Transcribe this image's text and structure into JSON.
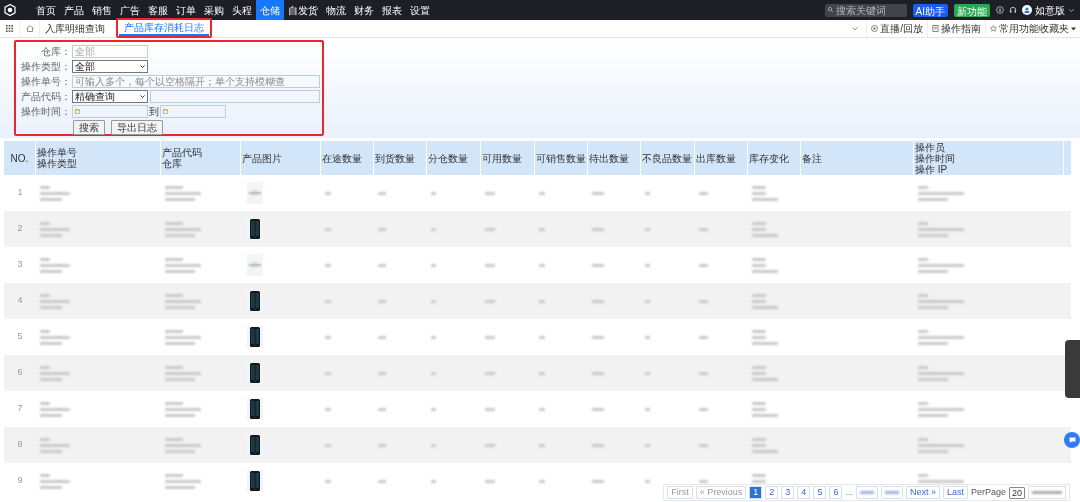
{
  "nav": {
    "items": [
      {
        "label": "首页",
        "selected": false
      },
      {
        "label": "产品",
        "selected": false
      },
      {
        "label": "销售",
        "selected": false
      },
      {
        "label": "广告",
        "selected": false
      },
      {
        "label": "客服",
        "selected": false
      },
      {
        "label": "订单",
        "selected": false
      },
      {
        "label": "采购",
        "selected": false
      },
      {
        "label": "头程",
        "selected": false
      },
      {
        "label": "仓储",
        "selected": true
      },
      {
        "label": "自发货",
        "selected": false
      },
      {
        "label": "物流",
        "selected": false
      },
      {
        "label": "财务",
        "selected": false
      },
      {
        "label": "报表",
        "selected": false
      },
      {
        "label": "设置",
        "selected": false
      }
    ],
    "search_placeholder": "搜索关键词",
    "ai_button": "AI助手",
    "new_button": "新功能",
    "user": "如意版"
  },
  "tabs": [
    {
      "label": "入库明细查询",
      "selected": false
    },
    {
      "label": "产品库存消耗日志",
      "selected": true
    }
  ],
  "toolbar": [
    "直播/回放",
    "操作指南",
    "常用功能收藏夹"
  ],
  "filters": {
    "warehouse_label": "仓库：",
    "warehouse_placeholder": "全部",
    "type_label": "操作类型：",
    "type_value": "全部",
    "order_label": "操作单号：",
    "order_placeholder": "可输入多个，每个以空格隔开；单个支持模糊查",
    "code_label": "产品代码：",
    "code_mode": "精确查询",
    "time_label": "操作时间：",
    "to_label": "到",
    "search_button": "搜索",
    "export_button": "导出日志"
  },
  "table": {
    "columns": [
      [
        "NO."
      ],
      [
        "操作单号",
        "操作类型"
      ],
      [
        "产品代码",
        "仓库"
      ],
      [
        "产品图片"
      ],
      [
        "在途数量"
      ],
      [
        "到货数量"
      ],
      [
        "分仓数量"
      ],
      [
        "可用数量"
      ],
      [
        "可销售数量"
      ],
      [
        "待出数量"
      ],
      [
        "不良品数量"
      ],
      [
        "出库数量"
      ],
      [
        "库存变化"
      ],
      [
        "备注"
      ],
      [
        "操作员",
        "操作时间",
        "操作 IP"
      ]
    ],
    "rows": [
      {
        "no": "1"
      },
      {
        "no": "2"
      },
      {
        "no": "3"
      },
      {
        "no": "4"
      },
      {
        "no": "5"
      },
      {
        "no": "6"
      },
      {
        "no": "7"
      },
      {
        "no": "8"
      },
      {
        "no": "9"
      }
    ]
  },
  "pagination": {
    "first": "First",
    "previous": "« Previous",
    "pages": [
      {
        "label": "1",
        "selected": true
      },
      {
        "label": "2",
        "selected": false
      },
      {
        "label": "3",
        "selected": false
      },
      {
        "label": "4",
        "selected": false
      },
      {
        "label": "5",
        "selected": false
      },
      {
        "label": "6",
        "selected": false
      }
    ],
    "ellipsis": "...",
    "next": "Next »",
    "last": "Last",
    "per_page_label": "PerPage",
    "per_page": "20"
  }
}
